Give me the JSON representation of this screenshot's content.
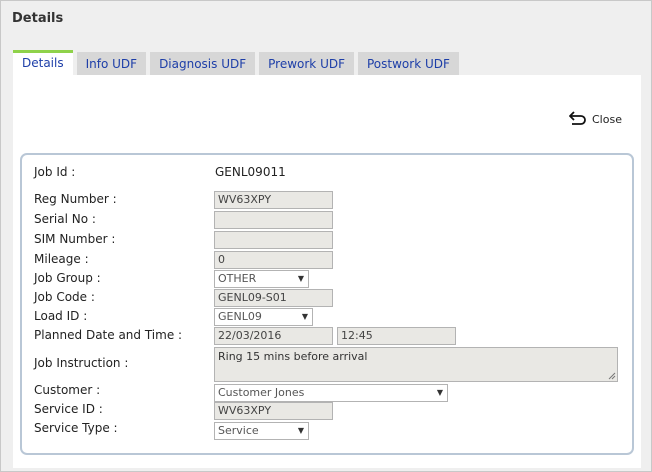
{
  "dialog": {
    "title": "Details"
  },
  "tabs": [
    {
      "label": "Details",
      "active": true
    },
    {
      "label": "Info UDF",
      "active": false
    },
    {
      "label": "Diagnosis UDF",
      "active": false
    },
    {
      "label": "Prework UDF",
      "active": false
    },
    {
      "label": "Postwork UDF",
      "active": false
    }
  ],
  "close": {
    "label": "Close",
    "icon": "undo-arrow-icon"
  },
  "form": {
    "job_id": {
      "label": "Job Id :",
      "value": "GENL09011"
    },
    "reg_number": {
      "label": "Reg Number :",
      "value": "WV63XPY"
    },
    "serial_no": {
      "label": "Serial No :",
      "value": ""
    },
    "sim_number": {
      "label": "SIM Number :",
      "value": ""
    },
    "mileage": {
      "label": "Mileage :",
      "value": "0"
    },
    "job_group": {
      "label": "Job Group :",
      "value": "OTHER"
    },
    "job_code": {
      "label": "Job Code :",
      "value": "GENL09-S01"
    },
    "load_id": {
      "label": "Load ID :",
      "value": "GENL09"
    },
    "planned": {
      "label": "Planned Date and Time :",
      "date": "22/03/2016",
      "time": "12:45"
    },
    "job_instruction": {
      "label": "Job Instruction :",
      "value": "Ring 15 mins before arrival"
    },
    "customer": {
      "label": "Customer :",
      "value": "Customer Jones"
    },
    "service_id": {
      "label": "Service ID :",
      "value": "WV63XPY"
    },
    "service_type": {
      "label": "Service Type :",
      "value": "Service"
    }
  }
}
